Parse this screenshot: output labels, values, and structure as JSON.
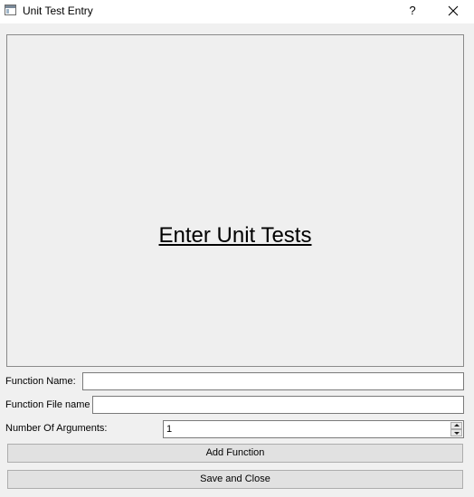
{
  "window": {
    "title": "Unit Test Entry",
    "help_label": "?",
    "help_icon": "question-mark",
    "close_icon": "close-x"
  },
  "main": {
    "heading": "Enter Unit Tests"
  },
  "form": {
    "function_name": {
      "label": "Function Name:",
      "value": ""
    },
    "function_file": {
      "label": "Function File name",
      "value": ""
    },
    "num_arguments": {
      "label": "Number Of Arguments:",
      "value": "1"
    }
  },
  "buttons": {
    "add_function": "Add Function",
    "save_and_close": "Save and Close"
  },
  "colors": {
    "background": "#f0f0f0",
    "titlebar": "#ffffff",
    "button": "#e1e1e1",
    "border": "#7a7a7a"
  }
}
